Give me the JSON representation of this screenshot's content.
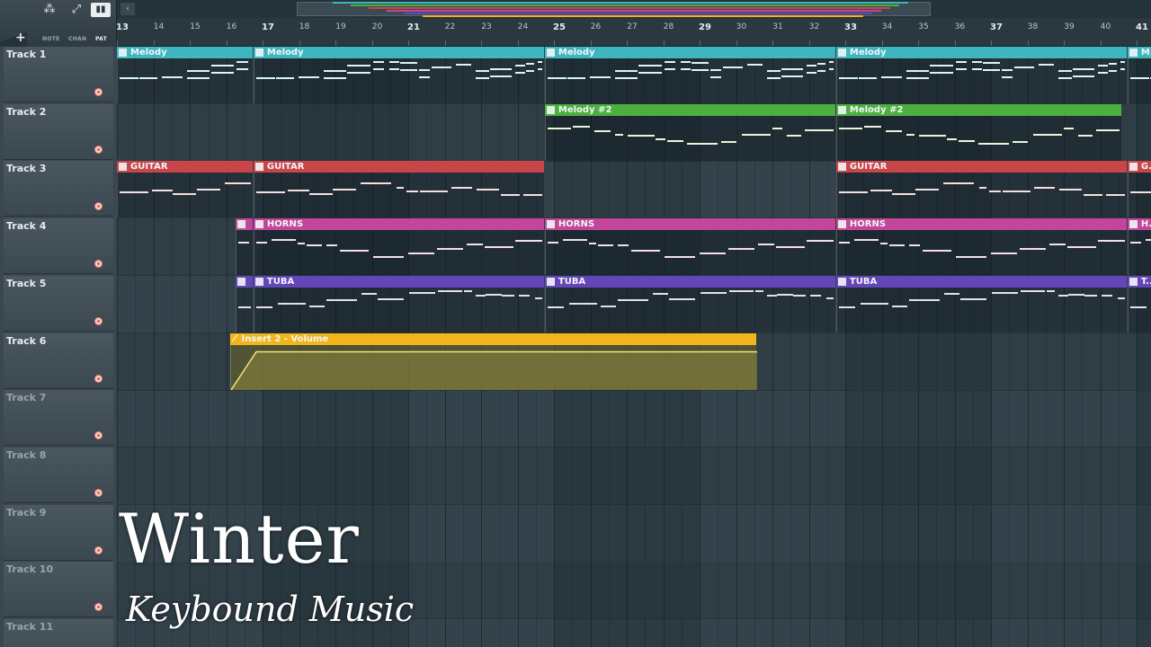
{
  "toolbar": {
    "modes": [
      "NOTE",
      "CHAN",
      "PAT"
    ],
    "active_mode": "PAT",
    "add_icon": "plus-icon"
  },
  "ruler": {
    "bars": [
      13,
      14,
      15,
      16,
      17,
      18,
      19,
      20,
      21,
      22,
      23,
      24,
      25,
      26,
      27,
      28,
      29,
      30,
      31,
      32,
      33,
      34,
      35,
      36,
      37,
      38,
      39,
      40,
      41
    ]
  },
  "tracks": [
    {
      "name": "Track 1",
      "active": true
    },
    {
      "name": "Track 2",
      "active": true
    },
    {
      "name": "Track 3",
      "active": true
    },
    {
      "name": "Track 4",
      "active": true
    },
    {
      "name": "Track 5",
      "active": true
    },
    {
      "name": "Track 6",
      "active": true
    },
    {
      "name": "Track 7",
      "active": false
    },
    {
      "name": "Track 8",
      "active": false
    },
    {
      "name": "Track 9",
      "active": false
    },
    {
      "name": "Track 10",
      "active": false
    },
    {
      "name": "Track 11",
      "active": false
    }
  ],
  "clips": [
    {
      "track": 0,
      "label": "Melody",
      "start": 13,
      "end": 16.75,
      "color": "#3db6bf",
      "notes": "#d9f6f7"
    },
    {
      "track": 0,
      "label": "Melody",
      "start": 16.75,
      "end": 24.75,
      "color": "#3db6bf",
      "notes": "#d9f6f7"
    },
    {
      "track": 0,
      "label": "Melody",
      "start": 24.75,
      "end": 32.75,
      "color": "#3db6bf",
      "notes": "#d9f6f7"
    },
    {
      "track": 0,
      "label": "Melody",
      "start": 32.75,
      "end": 40.75,
      "color": "#3db6bf",
      "notes": "#d9f6f7"
    },
    {
      "track": 0,
      "label": "M...",
      "start": 40.75,
      "end": 42,
      "color": "#3db6bf",
      "notes": "#d9f6f7"
    },
    {
      "track": 1,
      "label": "Melody #2",
      "start": 24.75,
      "end": 32.75,
      "color": "#4caf3f",
      "notes": "#e6f7dd"
    },
    {
      "track": 1,
      "label": "Melody #2",
      "start": 32.75,
      "end": 40.6,
      "color": "#4caf3f",
      "notes": "#e6f7dd"
    },
    {
      "track": 2,
      "label": "GUITAR",
      "start": 13,
      "end": 16.75,
      "color": "#c9454a",
      "notes": "#f8dede"
    },
    {
      "track": 2,
      "label": "GUITAR",
      "start": 16.75,
      "end": 24.75,
      "color": "#c9454a",
      "notes": "#f8dede"
    },
    {
      "track": 2,
      "label": "GUITAR",
      "start": 32.75,
      "end": 40.75,
      "color": "#c9454a",
      "notes": "#f8dede"
    },
    {
      "track": 2,
      "label": "G...",
      "start": 40.75,
      "end": 42,
      "color": "#c9454a",
      "notes": "#f8dede"
    },
    {
      "track": 3,
      "label": "",
      "start": 16.25,
      "end": 16.75,
      "color": "#c3469a",
      "notes": "#f6ddf0"
    },
    {
      "track": 3,
      "label": "HORNS",
      "start": 16.75,
      "end": 24.75,
      "color": "#c3469a",
      "notes": "#f6ddf0"
    },
    {
      "track": 3,
      "label": "HORNS",
      "start": 24.75,
      "end": 32.75,
      "color": "#c3469a",
      "notes": "#f6ddf0"
    },
    {
      "track": 3,
      "label": "HORNS",
      "start": 32.75,
      "end": 40.75,
      "color": "#c3469a",
      "notes": "#f6ddf0"
    },
    {
      "track": 3,
      "label": "H...",
      "start": 40.75,
      "end": 42,
      "color": "#c3469a",
      "notes": "#f6ddf0"
    },
    {
      "track": 4,
      "label": "",
      "start": 16.25,
      "end": 16.75,
      "color": "#6446b8",
      "notes": "#e6ddf7"
    },
    {
      "track": 4,
      "label": "TUBA",
      "start": 16.75,
      "end": 24.75,
      "color": "#6446b8",
      "notes": "#e6ddf7"
    },
    {
      "track": 4,
      "label": "TUBA",
      "start": 24.75,
      "end": 32.75,
      "color": "#6446b8",
      "notes": "#e6ddf7"
    },
    {
      "track": 4,
      "label": "TUBA",
      "start": 32.75,
      "end": 40.75,
      "color": "#6446b8",
      "notes": "#e6ddf7"
    },
    {
      "track": 4,
      "label": "T...",
      "start": 40.75,
      "end": 42,
      "color": "#6446b8",
      "notes": "#e6ddf7"
    }
  ],
  "automation": {
    "track": 5,
    "label": "Insert 2 - Volume",
    "start": 16.1,
    "end": 30.55,
    "color": "#f2b61c",
    "level": 0.85
  },
  "overlay": {
    "title": "Winter",
    "subtitle": "Keybound Music"
  }
}
